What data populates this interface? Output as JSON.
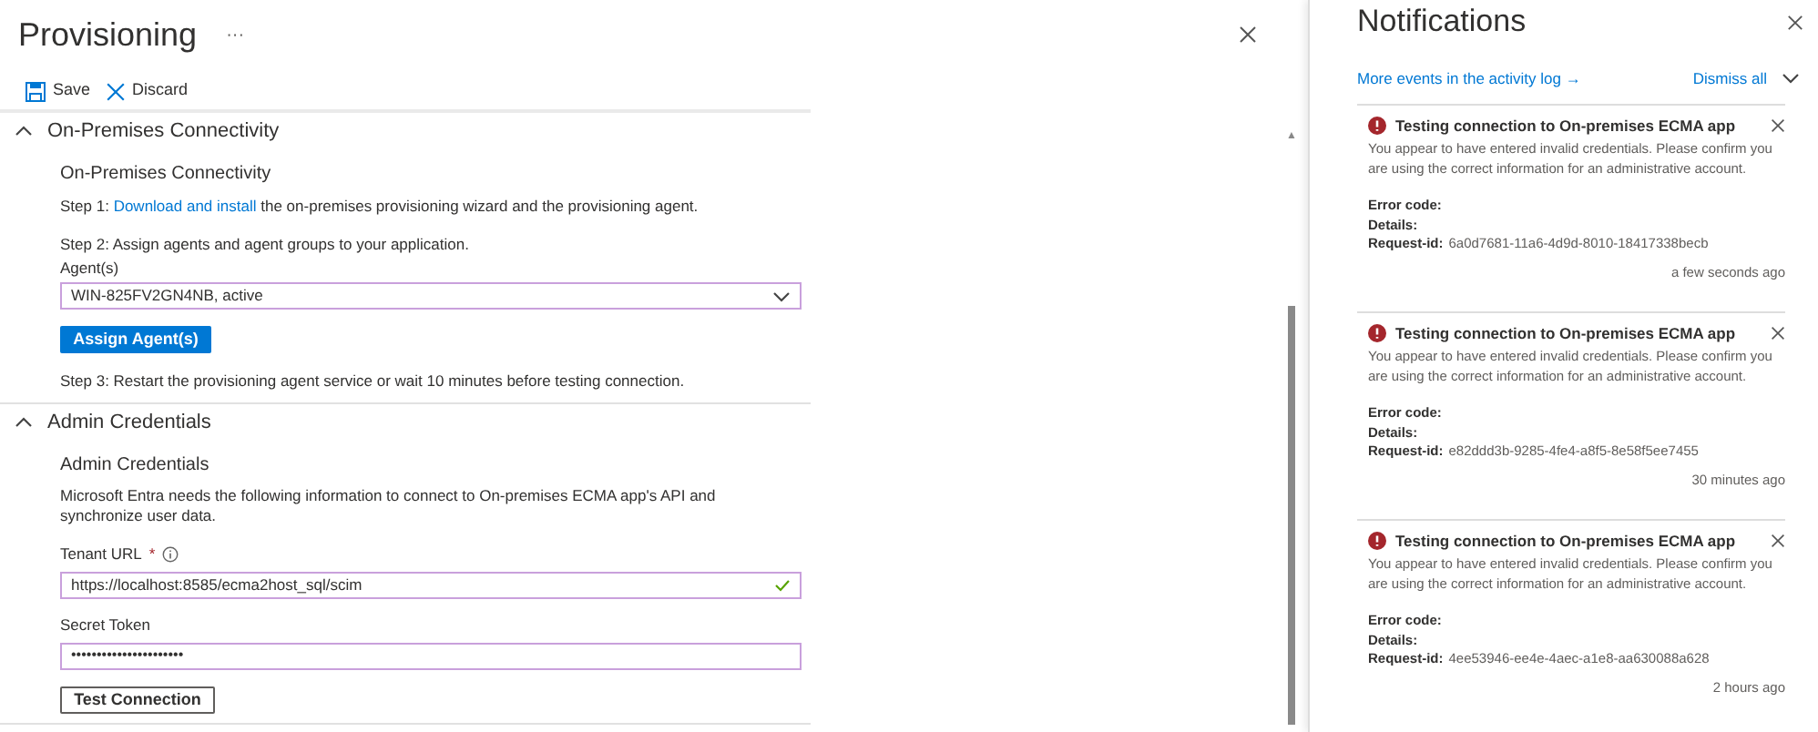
{
  "page": {
    "title": "Provisioning",
    "more": "···"
  },
  "toolbar": [
    {
      "kind": "save",
      "label": "Save"
    },
    {
      "kind": "discard",
      "label": "Discard"
    }
  ],
  "sections": [
    {
      "title": "On-Premises Connectivity",
      "expanded": true,
      "heading": "On-Premises Connectivity",
      "step1": {
        "prefix": "Step 1: ",
        "link": "Download and install",
        "suffix": " the on-premises provisioning wizard and the provisioning agent."
      },
      "step2": "Step 2: Assign agents and agent groups to your application.",
      "agents_label": "Agent(s)",
      "agents_value": "WIN-825FV2GN4NB, active",
      "assign_button": "Assign Agent(s)",
      "step3": "Step 3: Restart the provisioning agent service or wait 10 minutes before testing connection."
    },
    {
      "title": "Admin Credentials",
      "expanded": true,
      "heading": "Admin Credentials",
      "description": "Microsoft Entra needs the following information to connect to On-premises ECMA app's API and synchronize user data.",
      "tenant_label": "Tenant URL",
      "required_mark": "*",
      "tenant_value": "https://localhost:8585/ecma2host_sql/scim",
      "tenant_valid": true,
      "secret_label": "Secret Token",
      "secret_value": "••••••••••••••••••••••",
      "test_button": "Test Connection"
    }
  ],
  "scrollbar": {
    "up_arrow": "▲"
  },
  "notifications": {
    "title": "Notifications",
    "activity_link": "More events in the activity log →",
    "dismiss_all": "Dismiss all",
    "items": [
      {
        "title": "Testing connection to On-premises ECMA app",
        "message": "You appear to have entered invalid credentials. Please confirm you are using the correct information for an administrative account.",
        "error_code_label": "Error code:",
        "details_label": "Details:",
        "request_label": "Request-id:",
        "request_id": "6a0d7681-11a6-4d9d-8010-18417338becb",
        "time": "a few seconds ago"
      },
      {
        "title": "Testing connection to On-premises ECMA app",
        "message": "You appear to have entered invalid credentials. Please confirm you are using the correct information for an administrative account.",
        "error_code_label": "Error code:",
        "details_label": "Details:",
        "request_label": "Request-id:",
        "request_id": "e82ddd3b-9285-4fe4-a8f5-8e58f5ee7455",
        "time": "30 minutes ago"
      },
      {
        "title": "Testing connection to On-premises ECMA app",
        "message": "You appear to have entered invalid credentials. Please confirm you are using the correct information for an administrative account.",
        "error_code_label": "Error code:",
        "details_label": "Details:",
        "request_label": "Request-id:",
        "request_id": "4ee53946-ee4e-4aec-a1e8-aa630088a628",
        "time": "2 hours ago"
      }
    ]
  }
}
